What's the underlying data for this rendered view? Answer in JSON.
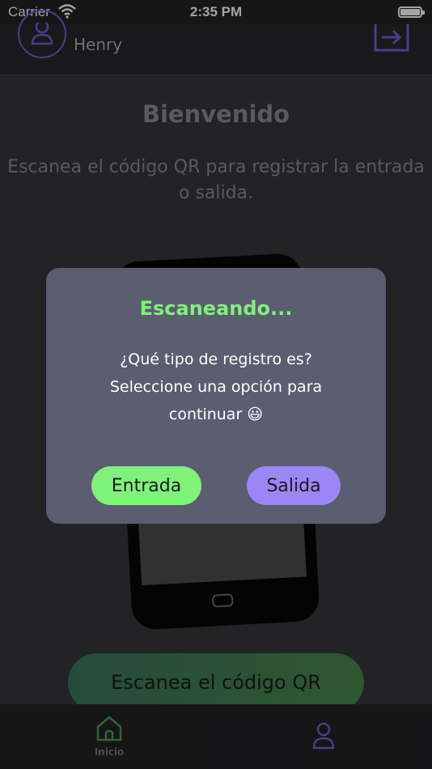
{
  "status_bar": {
    "carrier": "Carrier",
    "time": "2:35 PM",
    "battery_level": 1.0
  },
  "header": {
    "user_name": "Henry",
    "avatar_icon": "user-avatar-icon",
    "logout_icon": "logout-icon"
  },
  "main": {
    "title": "Bienvenido",
    "instruction_line1": "Escanea el código QR para registrar la entrada",
    "instruction_line2": "o salida.",
    "scan_button_label": "Escanea el código QR"
  },
  "dialog": {
    "title": "Escaneando...",
    "message_line1": "¿Qué tipo de registro es?",
    "message_line2": "Seleccione una opción para",
    "message_line3": "continuar 😃",
    "entrada_label": "Entrada",
    "salida_label": "Salida"
  },
  "tab_bar": {
    "home_label": "Inicio",
    "home_icon": "home-icon",
    "profile_icon": "profile-icon"
  },
  "colors": {
    "accent_green": "#7ef27a",
    "accent_purple": "#9b86f5",
    "dialog_bg": "#5b5d70"
  }
}
